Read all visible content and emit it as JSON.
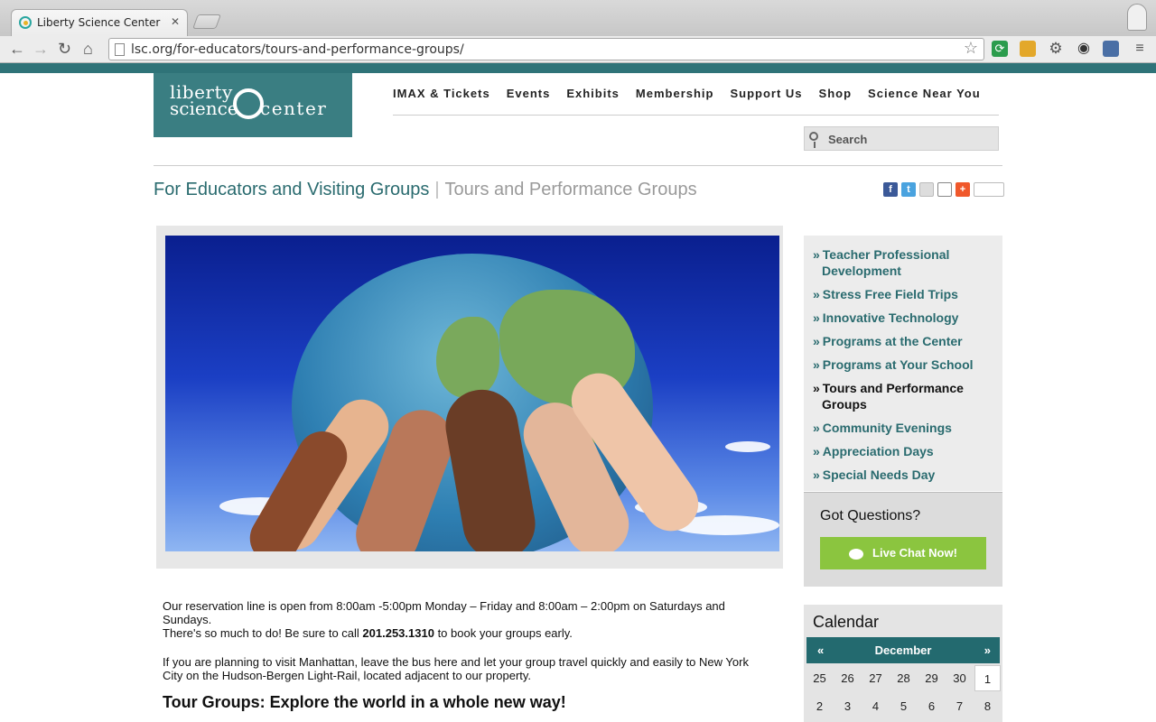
{
  "browser": {
    "tab_title": "Liberty Science Center",
    "tab_close": "✕",
    "url": "lsc.org/for-educators/tours-and-performance-groups/"
  },
  "logo": {
    "line1": "liberty",
    "line2": "science",
    "line3": "center"
  },
  "nav": {
    "items": [
      "IMAX & Tickets",
      "Events",
      "Exhibits",
      "Membership",
      "Support Us",
      "Shop",
      "Science Near You"
    ]
  },
  "search": {
    "placeholder": "Search"
  },
  "page": {
    "title": "For Educators and Visiting Groups",
    "separator": "|",
    "subtitle": "Tours and Performance Groups"
  },
  "body": {
    "p1_a": "Our reservation line is open from 8:00am -5:00pm Monday – Friday and 8:00am – 2:00pm on Saturdays and Sundays.",
    "p1_b": "There's so much to do! Be sure to call ",
    "p1_phone": "201.253.1310",
    "p1_c": " to book your groups early.",
    "p2": "If you are planning to visit Manhattan, leave the bus here and let your group travel quickly and easily to New York City on the Hudson-Bergen Light-Rail, located adjacent to our property.",
    "heading": "Tour Groups: Explore the world in a whole new way!"
  },
  "sidebar": {
    "items": [
      {
        "label": "Teacher Professional Development",
        "active": false
      },
      {
        "label": "Stress Free Field Trips",
        "active": false
      },
      {
        "label": "Innovative Technology",
        "active": false
      },
      {
        "label": "Programs at the Center",
        "active": false
      },
      {
        "label": "Programs at Your School",
        "active": false
      },
      {
        "label": "Tours and Performance Groups",
        "active": true
      },
      {
        "label": "Community Evenings",
        "active": false
      },
      {
        "label": "Appreciation Days",
        "active": false
      },
      {
        "label": "Special Needs Day",
        "active": false
      }
    ],
    "arrow": "»"
  },
  "questions": {
    "title": "Got Questions?",
    "chat_label": "Live Chat Now!"
  },
  "calendar": {
    "title": "Calendar",
    "prev": "«",
    "month": "December",
    "next": "»",
    "days": [
      "25",
      "26",
      "27",
      "28",
      "29",
      "30",
      "1",
      "2",
      "3",
      "4",
      "5",
      "6",
      "7",
      "8"
    ],
    "current": "1"
  },
  "colors": {
    "teal": "#2f7378",
    "link": "#2a6b6f",
    "chat_green": "#8bc53f"
  }
}
